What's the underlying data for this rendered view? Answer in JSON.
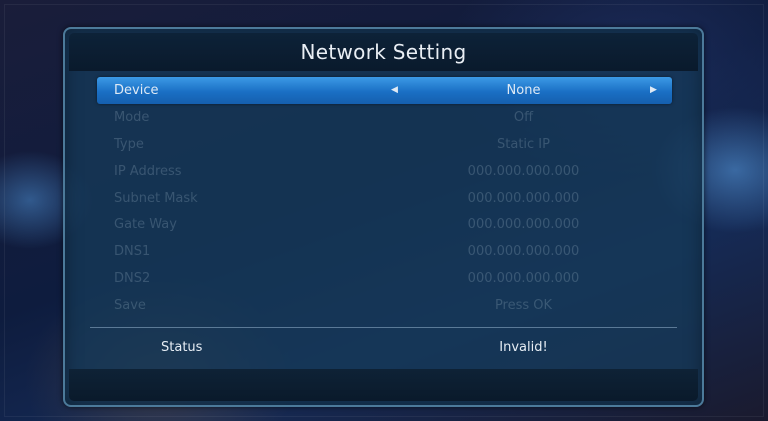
{
  "window": {
    "title": "Network Setting"
  },
  "menu": {
    "items": [
      {
        "label": "Device",
        "value": "None",
        "selected": true
      },
      {
        "label": "Mode",
        "value": "Off"
      },
      {
        "label": "Type",
        "value": "Static IP"
      },
      {
        "label": "IP Address",
        "value": "000.000.000.000"
      },
      {
        "label": "Subnet Mask",
        "value": "000.000.000.000"
      },
      {
        "label": "Gate Way",
        "value": "000.000.000.000"
      },
      {
        "label": "DNS1",
        "value": "000.000.000.000"
      },
      {
        "label": "DNS2",
        "value": "000.000.000.000"
      },
      {
        "label": "Save",
        "value": "Press OK"
      }
    ]
  },
  "status": {
    "label": "Status",
    "value": "Invalid!"
  },
  "icons": {
    "left": "arrow-left-icon",
    "right": "arrow-right-icon"
  },
  "colors": {
    "highlight": "#2a86d8",
    "panel": "#163a58",
    "border": "#4c7a9a"
  }
}
